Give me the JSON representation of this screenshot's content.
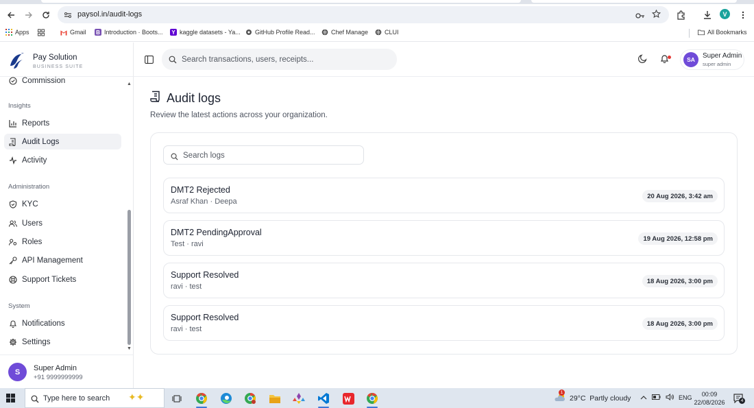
{
  "browser": {
    "url": "paysol.in/audit-logs",
    "profile_initial": "V",
    "bookmarks": [
      {
        "label": "Apps",
        "icon": "apps-grid-icon"
      },
      {
        "label": "",
        "icon": "grid-icon"
      },
      {
        "label": "Gmail",
        "icon": "gmail-icon"
      },
      {
        "label": "Introduction · Boots...",
        "icon": "bootstrap-icon"
      },
      {
        "label": "kaggle datasets - Ya...",
        "icon": "yahoo-icon"
      },
      {
        "label": "GitHub Profile Read...",
        "icon": "github-icon"
      },
      {
        "label": "Chef Manage",
        "icon": "globe-icon"
      },
      {
        "label": "CLUI",
        "icon": "globe-icon"
      }
    ],
    "all_bookmarks": "All Bookmarks"
  },
  "brand": {
    "name": "Pay Solution",
    "tagline": "BUSINESS SUITE"
  },
  "sidebar": {
    "partial_item": "Commission",
    "sections": [
      {
        "label": "Insights",
        "items": [
          {
            "label": "Reports",
            "icon": "chart-bars-icon",
            "active": false
          },
          {
            "label": "Audit Logs",
            "icon": "scroll-icon",
            "active": true
          },
          {
            "label": "Activity",
            "icon": "pulse-icon",
            "active": false
          }
        ]
      },
      {
        "label": "Administration",
        "items": [
          {
            "label": "KYC",
            "icon": "shield-check-icon",
            "active": false
          },
          {
            "label": "Users",
            "icon": "users-icon",
            "active": false
          },
          {
            "label": "Roles",
            "icon": "roles-icon",
            "active": false
          },
          {
            "label": "API Management",
            "icon": "key-icon",
            "active": false
          },
          {
            "label": "Support Tickets",
            "icon": "lifebuoy-icon",
            "active": false
          }
        ]
      },
      {
        "label": "System",
        "items": [
          {
            "label": "Notifications",
            "icon": "bell-icon",
            "active": false
          },
          {
            "label": "Settings",
            "icon": "gear-icon",
            "active": false
          }
        ]
      }
    ],
    "user": {
      "initial": "S",
      "name": "Super Admin",
      "phone": "+91 9999999999"
    }
  },
  "header": {
    "search_placeholder": "Search transactions, users, receipts...",
    "user": {
      "initials": "SA",
      "name": "Super Admin",
      "role": "super admin"
    }
  },
  "page": {
    "title": "Audit logs",
    "subtitle": "Review the latest actions across your organization.",
    "search_placeholder": "Search logs",
    "logs": [
      {
        "title": "DMT2 Rejected",
        "meta": "Asraf Khan · Deepa",
        "time": "20 Aug 2026, 3:42 am"
      },
      {
        "title": "DMT2 PendingApproval",
        "meta": "Test · ravi",
        "time": "19 Aug 2026, 12:58 pm"
      },
      {
        "title": "Support Resolved",
        "meta": "ravi · test",
        "time": "18 Aug 2026, 3:00 pm"
      },
      {
        "title": "Support Resolved",
        "meta": "ravi · test",
        "time": "18 Aug 2026, 3:00 pm"
      }
    ]
  },
  "taskbar": {
    "search_text": "Type here to search",
    "weather": "29°C  Partly cloudy",
    "weather_badge": "1",
    "language": "ENG",
    "time": "00:09",
    "date": "22/08/2026",
    "notification_count": "4"
  }
}
